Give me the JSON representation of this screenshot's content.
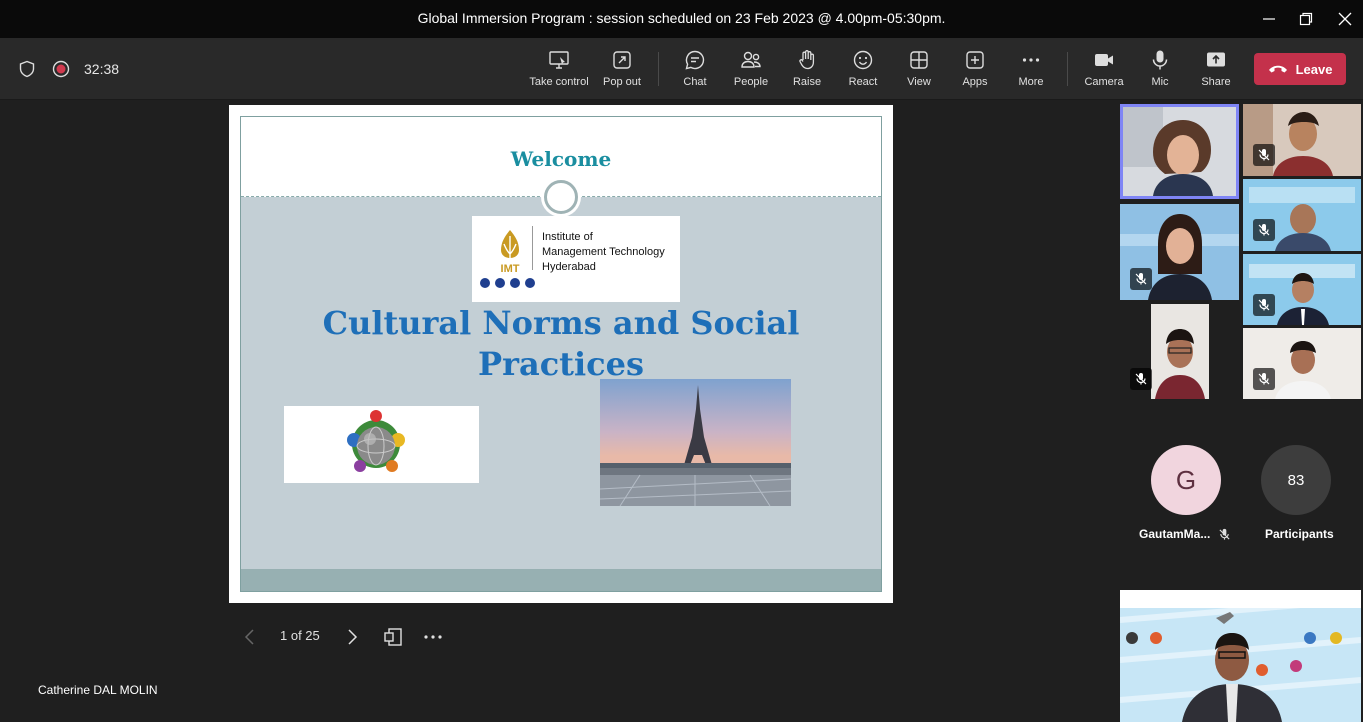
{
  "window": {
    "title": "Global Immersion Program : session scheduled on 23 Feb 2023 @ 4.00pm-05:30pm."
  },
  "toolbar": {
    "timer": "32:38",
    "buttons": {
      "take_control": "Take control",
      "pop_out": "Pop out",
      "chat": "Chat",
      "people": "People",
      "raise": "Raise",
      "react": "React",
      "view": "View",
      "apps": "Apps",
      "more": "More",
      "camera": "Camera",
      "mic": "Mic",
      "share": "Share"
    },
    "leave_label": "Leave",
    "leave_color": "#c4314b"
  },
  "slide": {
    "welcome": "Welcome",
    "logo": {
      "line1": "Institute of",
      "line2": "Management Technology",
      "line3": "Hyderabad",
      "mark_text": "IMT"
    },
    "title": "Cultural Norms and Social Practices",
    "page_indicator": "1 of 25",
    "accent": "#1e6fb8"
  },
  "presenter": {
    "name": "Catherine DAL MOLIN"
  },
  "participants": {
    "gautam": {
      "initial": "G",
      "name": "GautamMa..."
    },
    "overflow": {
      "count": "83",
      "label": "Participants"
    }
  }
}
